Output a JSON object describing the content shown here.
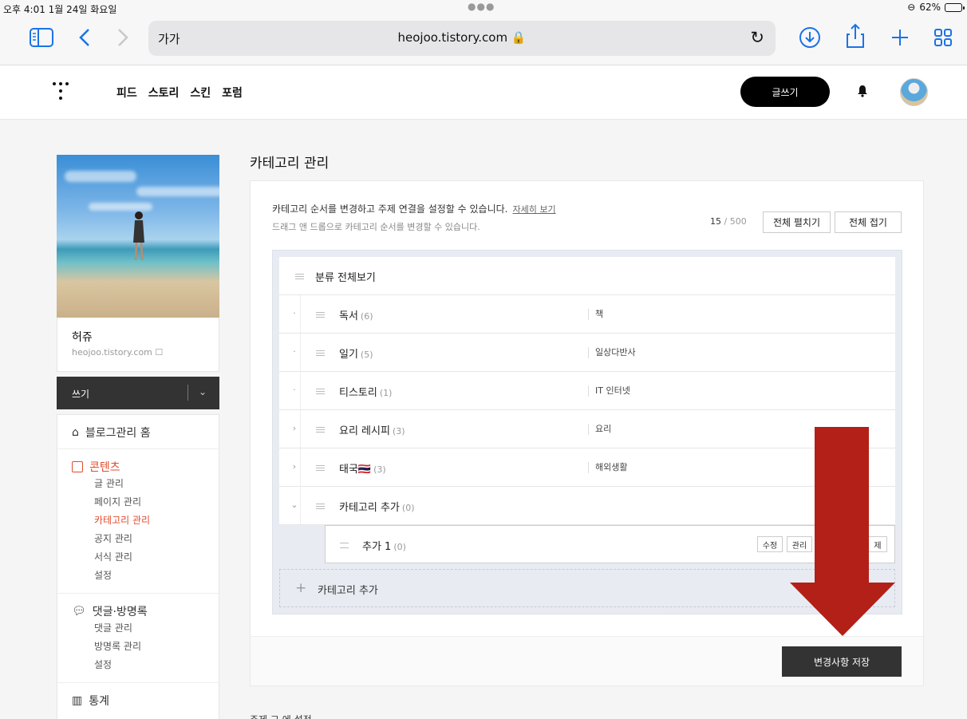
{
  "status": {
    "time": "오후 4:01  1월 24일 화요일",
    "battery": "62%"
  },
  "browser": {
    "aa": "가가",
    "url": "heojoo.tistory.com 🔒"
  },
  "nav": {
    "links": [
      "피드",
      "스토리",
      "스킨",
      "포럼"
    ],
    "write": "글쓰기"
  },
  "sidebar": {
    "name": "허쥬",
    "domain": "heojoo.tistory.com ☐",
    "write": "쓰기",
    "menu": [
      {
        "head": "블로그관리 홈",
        "items": []
      },
      {
        "head": "콘텐츠",
        "items": [
          "글 관리",
          "페이지 관리",
          "카테고리 관리",
          "공지 관리",
          "서식 관리",
          "설정"
        ]
      },
      {
        "head": "댓글·방명록",
        "items": [
          "댓글 관리",
          "방명록 관리",
          "설정"
        ]
      },
      {
        "head": "통계",
        "items": []
      }
    ]
  },
  "main": {
    "title": "카테고리 관리",
    "desc1": "카테고리 순서를 변경하고 주제 연결을 설정할 수 있습니다.",
    "more": "자세히 보기",
    "desc2": "드래그 앤 드롭으로 카테고리 순서를 변경할 수 있습니다.",
    "count": "15",
    "count_max": " / 500",
    "expand": "전체 펼치기",
    "collapse": "전체 접기",
    "all": "분류 전체보기",
    "rows": [
      {
        "tog": "·",
        "name": "독서",
        "count": "(6)",
        "topic": "책"
      },
      {
        "tog": "·",
        "name": "일기",
        "count": "(5)",
        "topic": "일상다반사"
      },
      {
        "tog": "·",
        "name": "티스토리",
        "count": "(1)",
        "topic": "IT 인터넷"
      },
      {
        "tog": "›",
        "name": "요리 레시피",
        "count": "(3)",
        "topic": "요리"
      },
      {
        "tog": "›",
        "name": "태국🇹🇭",
        "count": "(3)",
        "topic": "해외생활"
      },
      {
        "tog": "⌄",
        "name": "카테고리 추가",
        "count": "(0)",
        "topic": ""
      }
    ],
    "child": {
      "name": "추가 1",
      "count": "(0)",
      "edit": "수정",
      "manage": "관리",
      "delete": "제"
    },
    "add": "카테고리 추가",
    "save": "변경사항 저장",
    "cutoff": "주제 그 에 설정"
  }
}
